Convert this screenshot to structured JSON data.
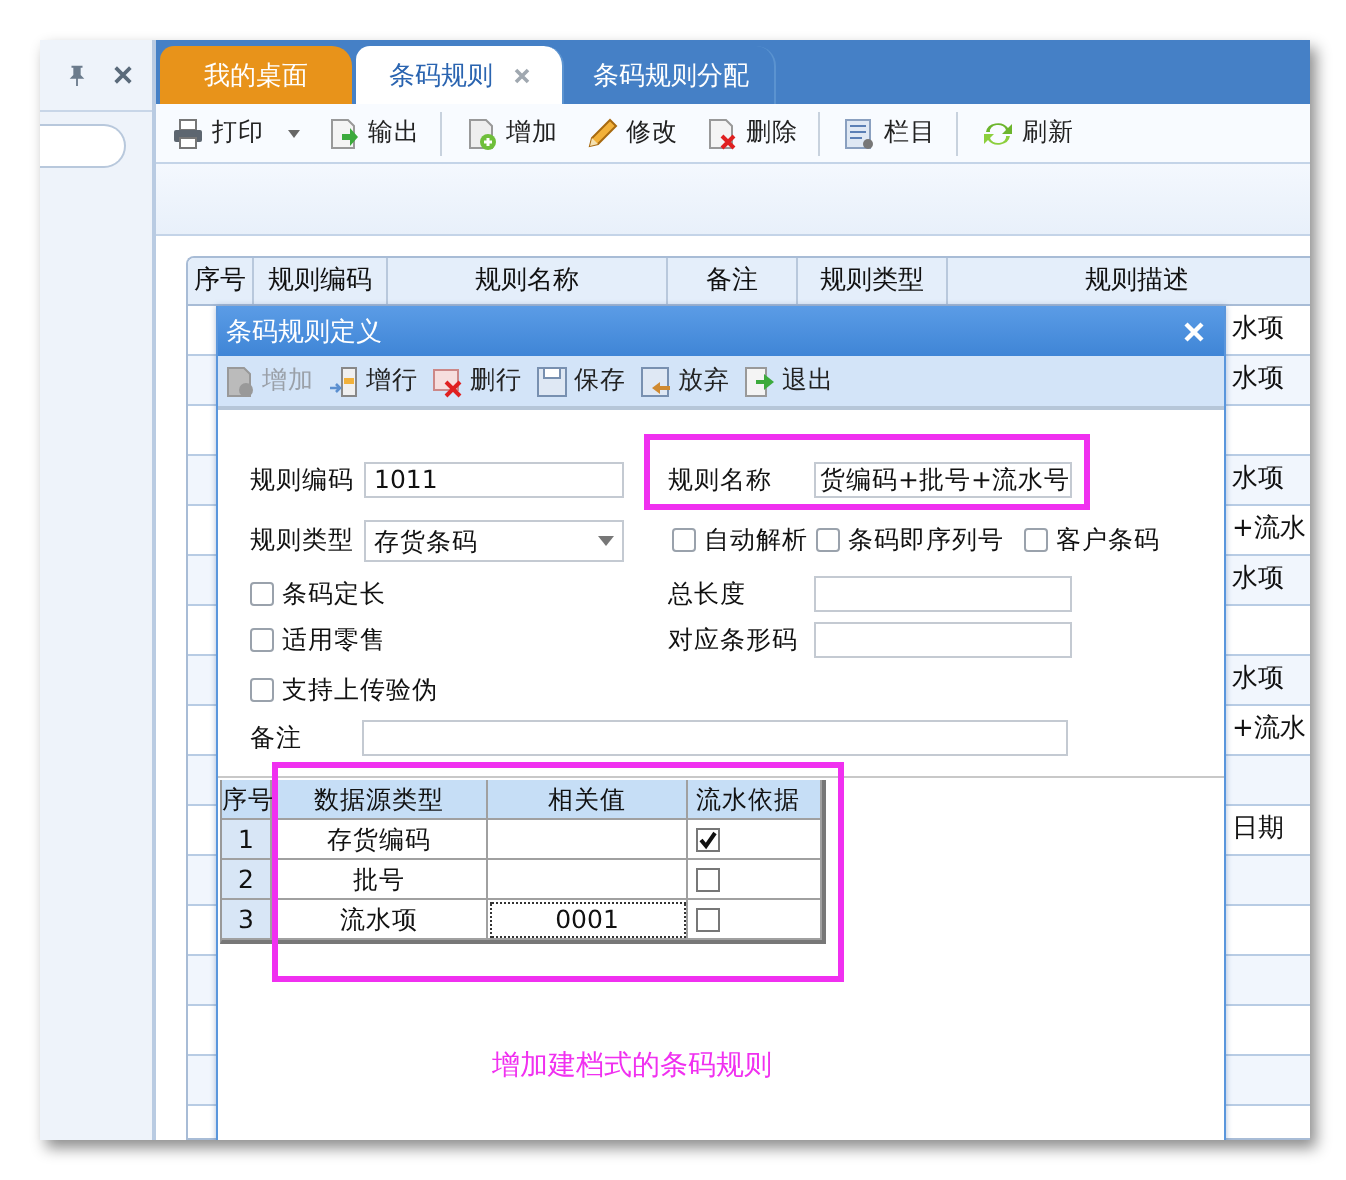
{
  "tabs": [
    {
      "label": "我的桌面",
      "kind": "home",
      "selected": false,
      "closable": false
    },
    {
      "label": "条码规则",
      "kind": "page",
      "selected": true,
      "closable": true
    },
    {
      "label": "条码规则分配",
      "kind": "page",
      "selected": false,
      "closable": false
    }
  ],
  "toolbar": {
    "groups": [
      [
        {
          "label": "打印",
          "dropdown": true
        },
        {
          "label": "输出",
          "dropdown": false
        }
      ],
      [
        {
          "label": "增加",
          "dropdown": false
        },
        {
          "label": "修改",
          "dropdown": false
        },
        {
          "label": "删除",
          "dropdown": false
        }
      ],
      [
        {
          "label": "栏目",
          "dropdown": false
        }
      ],
      [
        {
          "label": "刷新",
          "dropdown": false
        }
      ]
    ]
  },
  "grid": {
    "columns": [
      "序号",
      "规则编码",
      "规则名称",
      "备注",
      "规则类型",
      "规则描述"
    ],
    "rows": [
      {
        "column_6": "水项"
      },
      {
        "column_6": "水项"
      },
      {},
      {
        "column_6": "水项"
      },
      {
        "column_6": "+流水"
      },
      {
        "column_6": "水项"
      },
      {},
      {
        "column_6": "水项"
      },
      {
        "column_6": "+流水"
      },
      {},
      {
        "column_6": "日期"
      },
      {},
      {},
      {},
      {},
      {},
      {}
    ]
  },
  "dialog": {
    "title": "条码规则定义",
    "toolbar": [
      {
        "label": "增加",
        "disabled": true
      },
      {
        "label": "增行",
        "disabled": false
      },
      {
        "label": "删行",
        "disabled": false
      },
      {
        "label": "保存",
        "disabled": false
      },
      {
        "label": "放弃",
        "disabled": false
      },
      {
        "label": "退出",
        "disabled": false
      }
    ],
    "code": {
      "label": "规则编码",
      "value": "1011"
    },
    "name": {
      "label": "规则名称",
      "value": "货编码+批号+流水号"
    },
    "type": {
      "label": "规则类型",
      "value": "存货条码"
    },
    "options": [
      {
        "label": "自动解析",
        "checked": false
      },
      {
        "label": "条码即序列号",
        "checked": false
      },
      {
        "label": "客户条码",
        "checked": false
      }
    ],
    "fixed_length": {
      "label": "条码定长",
      "checked": false
    },
    "total_length": {
      "label": "总长度"
    },
    "retail": {
      "label": "适用零售",
      "checked": false
    },
    "barcode": {
      "label": "对应条形码"
    },
    "anti_fake": {
      "label": "支持上传验伪",
      "checked": false
    },
    "remark": {
      "label": "备注"
    },
    "table": {
      "columns": [
        "序号",
        "数据源类型",
        "相关值",
        "流水依据"
      ],
      "rows": [
        {
          "index": "1",
          "source": "存货编码",
          "serial": true,
          "focused": false
        },
        {
          "index": "2",
          "source": "批号",
          "serial": false,
          "focused": false
        },
        {
          "index": "3",
          "source": "流水项",
          "value": "0001",
          "serial": false,
          "focused": true
        }
      ]
    }
  },
  "annotation": {
    "text": "增加建档式的条码规则"
  }
}
